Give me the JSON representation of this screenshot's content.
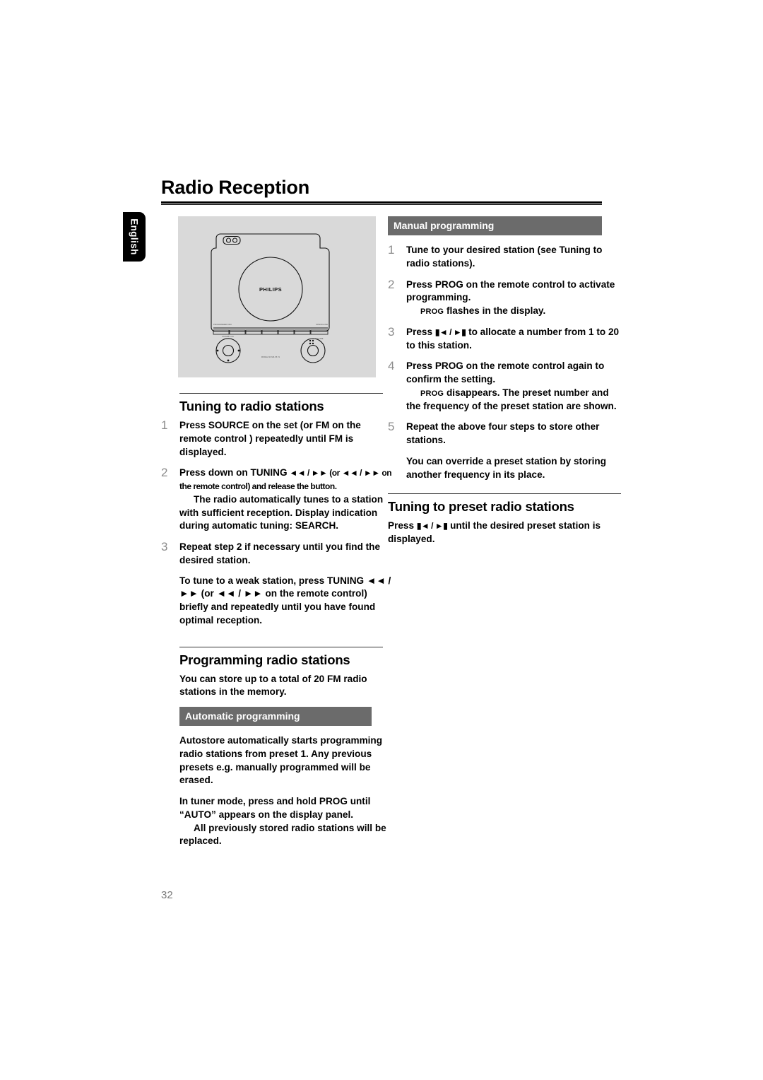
{
  "page": {
    "title": "Radio Reception",
    "language_tab": "English",
    "page_number": "32"
  },
  "illustration": {
    "brand": "PHILIPS",
    "alt_name": "hi-fi-system-front-view"
  },
  "left_column": {
    "tuning": {
      "heading": "Tuning to radio stations",
      "steps": [
        {
          "num": "1",
          "parts": [
            "Press ",
            "SOURCE",
            " on the set (or ",
            "FM",
            " on the remote control ) repeatedly until FM is displayed."
          ]
        },
        {
          "num": "2",
          "parts": [
            "Press down on ",
            "TUNING",
            " ◄◄ / ►►  (or ◄◄ / ►► on the remote control) and release the button."
          ],
          "note": "The radio automatically tunes to a station with sufficient reception. Display indication during automatic tuning: SEARCH."
        },
        {
          "num": "3",
          "parts": [
            "Repeat step ",
            "2",
            " if necessary until you find the desired station."
          ],
          "note": "To tune to a weak station, press TUNING ◄◄ / ►►  (or ◄◄ / ►► on the remote control) briefly and repeatedly until you have found optimal reception."
        }
      ]
    },
    "programming": {
      "heading": "Programming radio stations",
      "intro": "You can store up to a total of 20 FM radio stations  in the memory.",
      "auto_bar": "Automatic programming",
      "auto_p1": "Autostore automatically starts programming radio stations from preset 1. Any previous presets e.g. manually programmed will be erased.",
      "auto_p2_pre": "In tuner mode, press and hold ",
      "auto_p2_key": "PROG",
      "auto_p2_post": " until “AUTO” appears on the display panel.",
      "auto_p3": "All previously stored radio stations will be replaced."
    }
  },
  "right_column": {
    "manual_bar": "Manual programming",
    "steps": [
      {
        "num": "1",
        "text": "Tune to your desired station (see Tuning to radio stations)."
      },
      {
        "num": "2",
        "pre": "Press ",
        "key": "PROG",
        "post": " on the remote control to activate programming.",
        "note_key": "PROG",
        "note": " flashes in the display."
      },
      {
        "num": "3",
        "pre": "Press ",
        "key": "▮◄ / ►▮",
        "post": " to allocate a number from 1 to 20 to this station."
      },
      {
        "num": "4",
        "pre": "Press ",
        "key": "PROG",
        "post": " on the remote control again to confirm the setting.",
        "note_key": "PROG",
        "note": " disappears. The preset number and the frequency of the preset station are shown."
      },
      {
        "num": "5",
        "text": "Repeat the above four steps to store other stations."
      }
    ],
    "override_note": "You can override a preset station by storing another frequency in its place.",
    "preset": {
      "heading": "Tuning to preset radio stations",
      "pre": "Press ",
      "key": "▮◄ / ►▮",
      "post": " until the desired preset station is displayed."
    }
  }
}
